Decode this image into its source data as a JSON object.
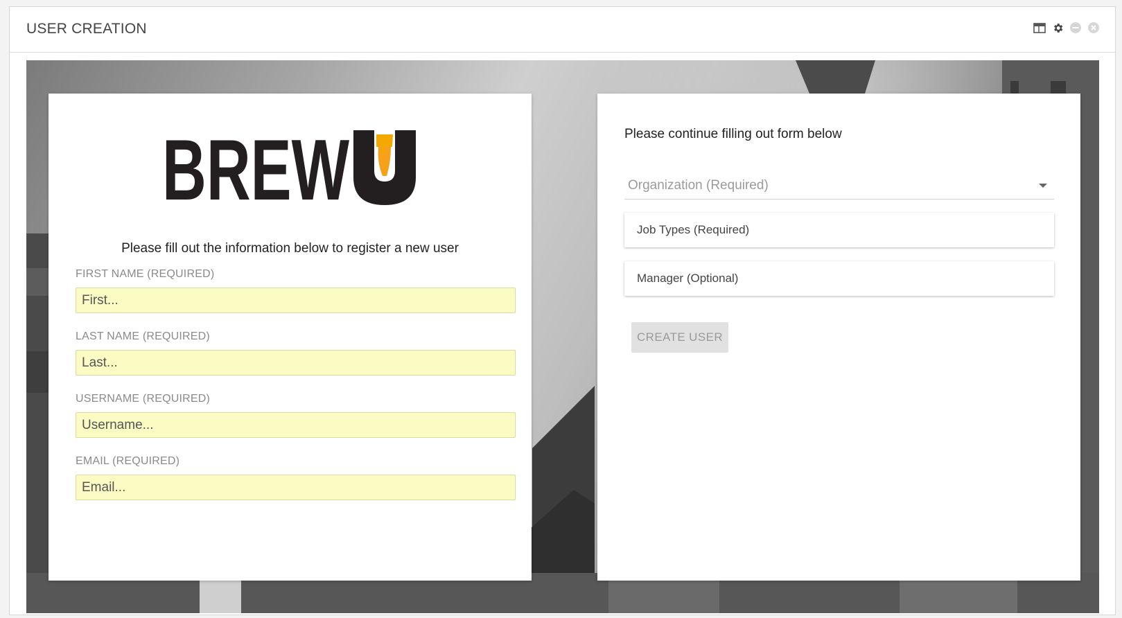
{
  "window": {
    "title": "USER CREATION",
    "controls": [
      {
        "icon": "layout-icon"
      },
      {
        "icon": "gear-icon"
      },
      {
        "icon": "minimize-icon"
      },
      {
        "icon": "close-icon"
      }
    ]
  },
  "left_card": {
    "logo": {
      "text": "BREWU",
      "icon": "beer-glass-icon",
      "accent": "#f5a800"
    },
    "intro": "Please fill out the information below to register a new user",
    "fields": [
      {
        "label": "FIRST NAME (REQUIRED)",
        "placeholder": "First..."
      },
      {
        "label": "LAST NAME (REQUIRED)",
        "placeholder": "Last..."
      },
      {
        "label": "USERNAME (REQUIRED)",
        "placeholder": "Username..."
      },
      {
        "label": "EMAIL (REQUIRED)",
        "placeholder": "Email..."
      }
    ]
  },
  "right_card": {
    "heading": "Please continue filling out form below",
    "organization": {
      "placeholder": "Organization (Required)"
    },
    "job_types": {
      "placeholder": "Job Types (Required)"
    },
    "manager": {
      "placeholder": "Manager (Optional)"
    },
    "create_button": "CREATE USER"
  },
  "colors": {
    "input_autofill_bg": "#fafcc4",
    "button_disabled_bg": "#e1e1e1",
    "logo_dark": "#231f20",
    "logo_accent": "#f5a800"
  }
}
